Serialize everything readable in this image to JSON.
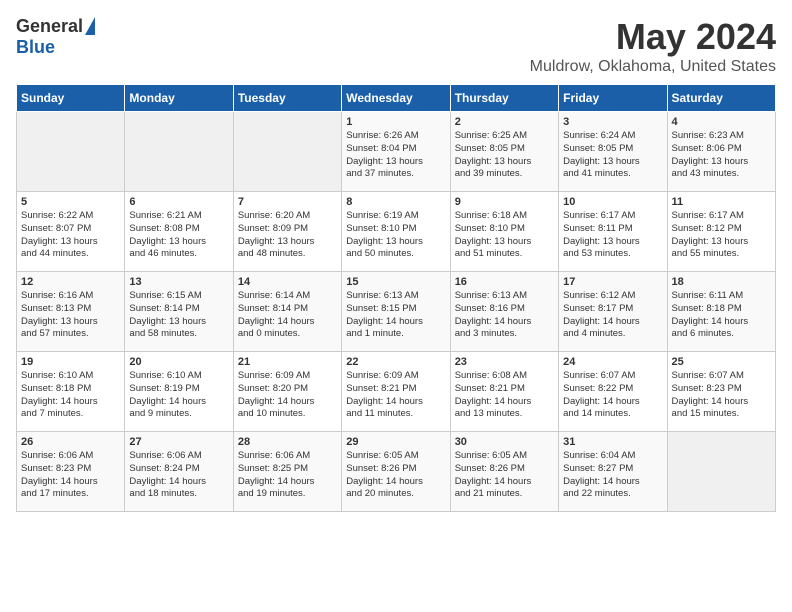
{
  "logo": {
    "general": "General",
    "blue": "Blue"
  },
  "title": "May 2024",
  "location": "Muldrow, Oklahoma, United States",
  "weekdays": [
    "Sunday",
    "Monday",
    "Tuesday",
    "Wednesday",
    "Thursday",
    "Friday",
    "Saturday"
  ],
  "weeks": [
    [
      {
        "day": "",
        "info": ""
      },
      {
        "day": "",
        "info": ""
      },
      {
        "day": "",
        "info": ""
      },
      {
        "day": "1",
        "info": "Sunrise: 6:26 AM\nSunset: 8:04 PM\nDaylight: 13 hours\nand 37 minutes."
      },
      {
        "day": "2",
        "info": "Sunrise: 6:25 AM\nSunset: 8:05 PM\nDaylight: 13 hours\nand 39 minutes."
      },
      {
        "day": "3",
        "info": "Sunrise: 6:24 AM\nSunset: 8:05 PM\nDaylight: 13 hours\nand 41 minutes."
      },
      {
        "day": "4",
        "info": "Sunrise: 6:23 AM\nSunset: 8:06 PM\nDaylight: 13 hours\nand 43 minutes."
      }
    ],
    [
      {
        "day": "5",
        "info": "Sunrise: 6:22 AM\nSunset: 8:07 PM\nDaylight: 13 hours\nand 44 minutes."
      },
      {
        "day": "6",
        "info": "Sunrise: 6:21 AM\nSunset: 8:08 PM\nDaylight: 13 hours\nand 46 minutes."
      },
      {
        "day": "7",
        "info": "Sunrise: 6:20 AM\nSunset: 8:09 PM\nDaylight: 13 hours\nand 48 minutes."
      },
      {
        "day": "8",
        "info": "Sunrise: 6:19 AM\nSunset: 8:10 PM\nDaylight: 13 hours\nand 50 minutes."
      },
      {
        "day": "9",
        "info": "Sunrise: 6:18 AM\nSunset: 8:10 PM\nDaylight: 13 hours\nand 51 minutes."
      },
      {
        "day": "10",
        "info": "Sunrise: 6:17 AM\nSunset: 8:11 PM\nDaylight: 13 hours\nand 53 minutes."
      },
      {
        "day": "11",
        "info": "Sunrise: 6:17 AM\nSunset: 8:12 PM\nDaylight: 13 hours\nand 55 minutes."
      }
    ],
    [
      {
        "day": "12",
        "info": "Sunrise: 6:16 AM\nSunset: 8:13 PM\nDaylight: 13 hours\nand 57 minutes."
      },
      {
        "day": "13",
        "info": "Sunrise: 6:15 AM\nSunset: 8:14 PM\nDaylight: 13 hours\nand 58 minutes."
      },
      {
        "day": "14",
        "info": "Sunrise: 6:14 AM\nSunset: 8:14 PM\nDaylight: 14 hours\nand 0 minutes."
      },
      {
        "day": "15",
        "info": "Sunrise: 6:13 AM\nSunset: 8:15 PM\nDaylight: 14 hours\nand 1 minute."
      },
      {
        "day": "16",
        "info": "Sunrise: 6:13 AM\nSunset: 8:16 PM\nDaylight: 14 hours\nand 3 minutes."
      },
      {
        "day": "17",
        "info": "Sunrise: 6:12 AM\nSunset: 8:17 PM\nDaylight: 14 hours\nand 4 minutes."
      },
      {
        "day": "18",
        "info": "Sunrise: 6:11 AM\nSunset: 8:18 PM\nDaylight: 14 hours\nand 6 minutes."
      }
    ],
    [
      {
        "day": "19",
        "info": "Sunrise: 6:10 AM\nSunset: 8:18 PM\nDaylight: 14 hours\nand 7 minutes."
      },
      {
        "day": "20",
        "info": "Sunrise: 6:10 AM\nSunset: 8:19 PM\nDaylight: 14 hours\nand 9 minutes."
      },
      {
        "day": "21",
        "info": "Sunrise: 6:09 AM\nSunset: 8:20 PM\nDaylight: 14 hours\nand 10 minutes."
      },
      {
        "day": "22",
        "info": "Sunrise: 6:09 AM\nSunset: 8:21 PM\nDaylight: 14 hours\nand 11 minutes."
      },
      {
        "day": "23",
        "info": "Sunrise: 6:08 AM\nSunset: 8:21 PM\nDaylight: 14 hours\nand 13 minutes."
      },
      {
        "day": "24",
        "info": "Sunrise: 6:07 AM\nSunset: 8:22 PM\nDaylight: 14 hours\nand 14 minutes."
      },
      {
        "day": "25",
        "info": "Sunrise: 6:07 AM\nSunset: 8:23 PM\nDaylight: 14 hours\nand 15 minutes."
      }
    ],
    [
      {
        "day": "26",
        "info": "Sunrise: 6:06 AM\nSunset: 8:23 PM\nDaylight: 14 hours\nand 17 minutes."
      },
      {
        "day": "27",
        "info": "Sunrise: 6:06 AM\nSunset: 8:24 PM\nDaylight: 14 hours\nand 18 minutes."
      },
      {
        "day": "28",
        "info": "Sunrise: 6:06 AM\nSunset: 8:25 PM\nDaylight: 14 hours\nand 19 minutes."
      },
      {
        "day": "29",
        "info": "Sunrise: 6:05 AM\nSunset: 8:26 PM\nDaylight: 14 hours\nand 20 minutes."
      },
      {
        "day": "30",
        "info": "Sunrise: 6:05 AM\nSunset: 8:26 PM\nDaylight: 14 hours\nand 21 minutes."
      },
      {
        "day": "31",
        "info": "Sunrise: 6:04 AM\nSunset: 8:27 PM\nDaylight: 14 hours\nand 22 minutes."
      },
      {
        "day": "",
        "info": ""
      }
    ]
  ]
}
